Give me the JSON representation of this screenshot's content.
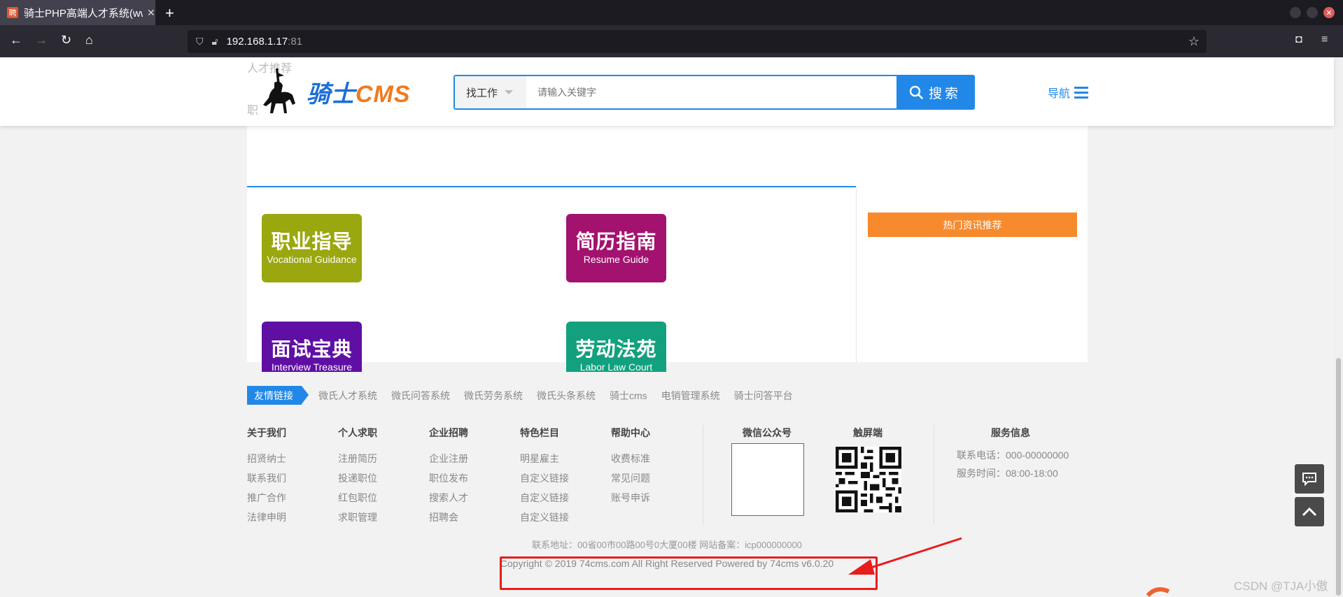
{
  "browser": {
    "tab_title": "骑士PHP高端人才系统(ww",
    "favicon_text": "聘",
    "url_host": "192.168.1.17",
    "url_port": ":81"
  },
  "header": {
    "ghost_text_1": "人才推荐",
    "ghost_text_2": "职",
    "brand_main": "骑士",
    "brand_suffix": "CMS",
    "search_type": "找工作",
    "search_placeholder": "请输入关键字",
    "search_button": "搜索",
    "nav_label": "导航"
  },
  "tiles": [
    {
      "cn": "职业指导",
      "en": "Vocational Guidance",
      "color": "#9aa70e"
    },
    {
      "cn": "简历指南",
      "en": "Resume Guide",
      "color": "#a3126f"
    },
    {
      "cn": "面试宝典",
      "en": "Interview Treasure",
      "color": "#5f0fa4"
    },
    {
      "cn": "劳动法苑",
      "en": "Labor Law Court",
      "color": "#12a07e"
    }
  ],
  "sidebar": {
    "hot_news": "热门资讯推荐"
  },
  "friend_links": {
    "tag": "友情链接",
    "items": [
      "微氏人才系统",
      "微氏问答系统",
      "微氏劳务系统",
      "微氏头条系统",
      "骑士cms",
      "电销管理系统",
      "骑士问答平台"
    ]
  },
  "footer_columns": [
    {
      "title": "关于我们",
      "items": [
        "招贤纳士",
        "联系我们",
        "推广合作",
        "法律申明"
      ]
    },
    {
      "title": "个人求职",
      "items": [
        "注册简历",
        "投递职位",
        "红包职位",
        "求职管理"
      ]
    },
    {
      "title": "企业招聘",
      "items": [
        "企业注册",
        "职位发布",
        "搜索人才",
        "招聘会"
      ]
    },
    {
      "title": "特色栏目",
      "items": [
        "明星雇主",
        "自定义链接",
        "自定义链接",
        "自定义链接"
      ]
    },
    {
      "title": "帮助中心",
      "items": [
        "收费标准",
        "常见问题",
        "账号申诉"
      ]
    }
  ],
  "qr": {
    "wechat_title": "微信公众号",
    "touch_title": "触屏端"
  },
  "service": {
    "title": "服务信息",
    "phone": "联系电话：000-00000000",
    "hours": "服务时间：08:00-18:00"
  },
  "address": "联系地址：00省00市00路00号0大厦00楼  网站备案：icp000000000",
  "copyright": "Copyright © 2019 74cms.com All Right Reserved Powered by 74cms v6.0.20",
  "watermark": "CSDN @TJA小傲"
}
